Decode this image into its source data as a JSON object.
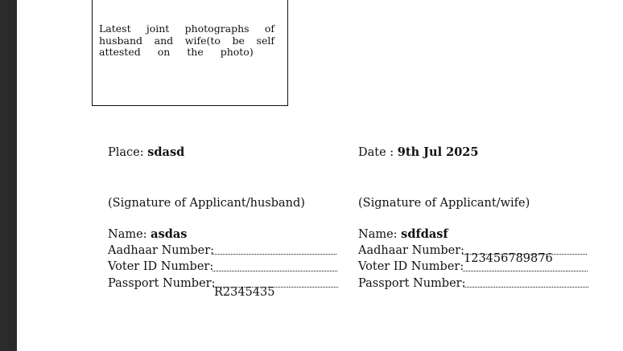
{
  "photo_box": {
    "lines": [
      "Latest joint photographs of",
      "husband and wife(to be self",
      "attested on the photo)"
    ]
  },
  "place": {
    "label": "Place:",
    "value": "sdasd"
  },
  "date": {
    "label": "Date :",
    "value": "9th Jul 2025"
  },
  "husband": {
    "signature": "(Signature of Applicant/husband)",
    "name_label": "Name:",
    "name_value": "asdas",
    "aadhaar_label": "Aadhaar Number:",
    "aadhaar_value": "",
    "voter_label": "Voter ID Number:",
    "voter_value": "",
    "passport_label": "Passport Number:",
    "passport_value": "R2345435"
  },
  "wife": {
    "signature": "(Signature of Applicant/wife)",
    "name_label": "Name:",
    "name_value": "sdfdasf",
    "aadhaar_label": "Aadhaar Number:",
    "aadhaar_value": "123456789876",
    "voter_label": "Voter ID Number:",
    "voter_value": "",
    "passport_label": "Passport Number:",
    "passport_value": ""
  }
}
